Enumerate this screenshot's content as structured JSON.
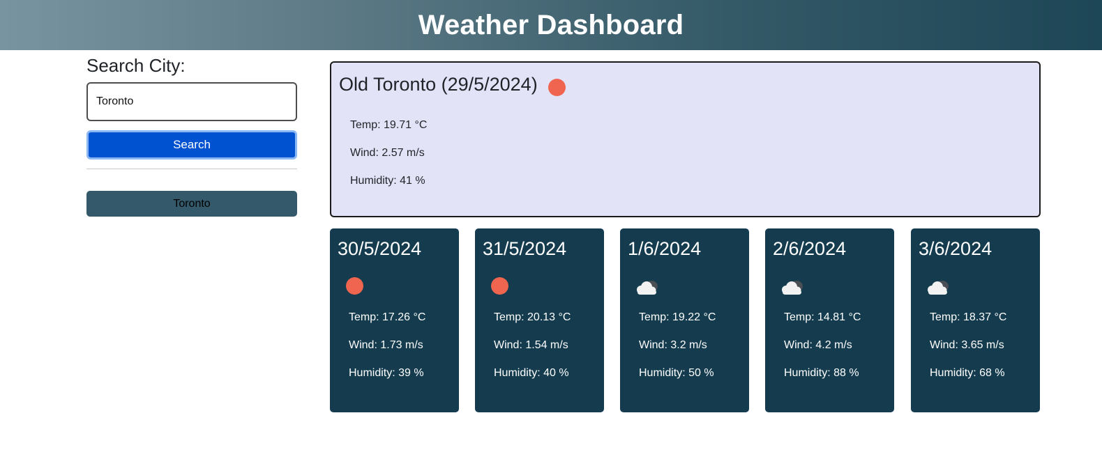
{
  "header": {
    "title": "Weather Dashboard"
  },
  "sidebar": {
    "label": "Search City:",
    "input_value": "Toronto",
    "search_label": "Search",
    "history": [
      "Toronto"
    ]
  },
  "current": {
    "title": "Old Toronto (29/5/2024)",
    "icon": "sun-icon",
    "temp": "Temp: 19.71 °C",
    "wind": "Wind: 2.57 m/s",
    "humidity": "Humidity: 41 %"
  },
  "forecast": [
    {
      "date": "30/5/2024",
      "icon": "sun-icon",
      "temp": "Temp: 17.26 °C",
      "wind": "Wind: 1.73 m/s",
      "humidity": "Humidity: 39 %"
    },
    {
      "date": "31/5/2024",
      "icon": "sun-icon",
      "temp": "Temp: 20.13 °C",
      "wind": "Wind: 1.54 m/s",
      "humidity": "Humidity: 40 %"
    },
    {
      "date": "1/6/2024",
      "icon": "cloud-icon",
      "temp": "Temp: 19.22 °C",
      "wind": "Wind: 3.2 m/s",
      "humidity": "Humidity: 50 %"
    },
    {
      "date": "2/6/2024",
      "icon": "cloud-icon",
      "temp": "Temp: 14.81 °C",
      "wind": "Wind: 4.2 m/s",
      "humidity": "Humidity: 88 %"
    },
    {
      "date": "3/6/2024",
      "icon": "cloud-icon",
      "temp": "Temp: 18.37 °C",
      "wind": "Wind: 3.65 m/s",
      "humidity": "Humidity: 68 %"
    }
  ],
  "colors": {
    "sun": "#ef654f",
    "search_button": "#0052d0",
    "history_button": "#34596b",
    "forecast_card": "#143c4e",
    "current_card": "#e2e3f7"
  }
}
